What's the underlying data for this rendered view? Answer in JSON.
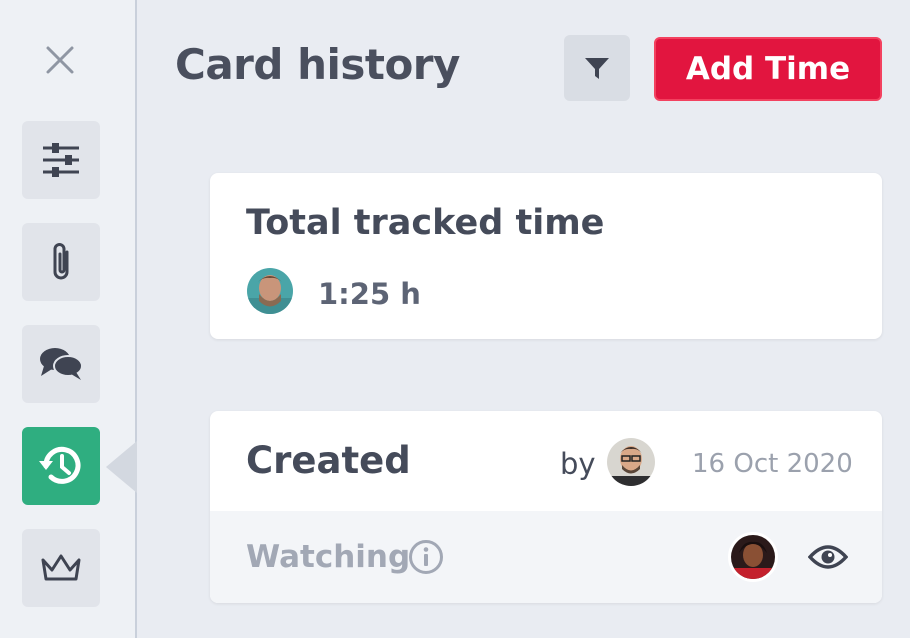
{
  "header": {
    "title": "Card history",
    "add_time_label": "Add Time"
  },
  "rail": {
    "icons": [
      "close-icon",
      "sliders-icon",
      "paperclip-icon",
      "comments-icon",
      "history-icon",
      "crown-icon"
    ],
    "active": "history"
  },
  "tracked": {
    "title": "Total tracked time",
    "entries": [
      {
        "value": "1:25 h"
      }
    ]
  },
  "history": {
    "event": "Created",
    "by_label": "by",
    "date": "16 Oct 2020",
    "watching_label": "Watching"
  },
  "colors": {
    "accent_red": "#e2153f",
    "accent_green": "#2fae80",
    "background": "#e9ecf2"
  }
}
